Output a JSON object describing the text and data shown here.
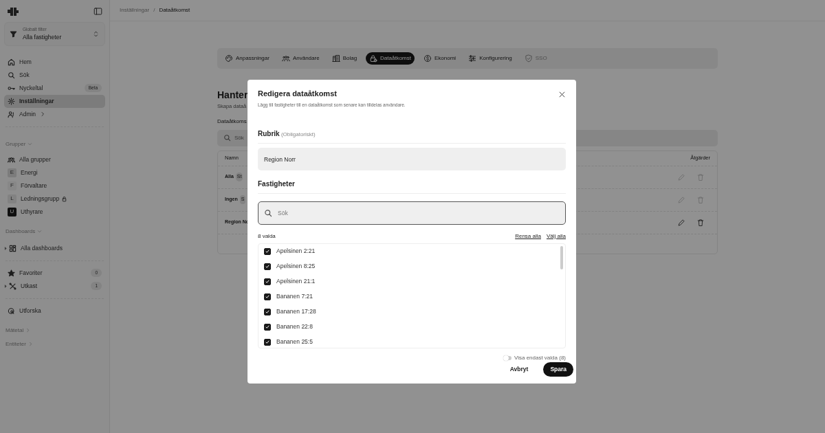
{
  "sidebar": {
    "global_filter": {
      "label": "Globalt filter",
      "value": "Alla fastigheter"
    },
    "nav": [
      {
        "label": "Hem",
        "selected": false
      },
      {
        "label": "Sök",
        "selected": false
      },
      {
        "label": "Nyckeltal",
        "badge": "Beta",
        "selected": false
      },
      {
        "label": "Inställningar",
        "selected": true
      },
      {
        "label": "Admin",
        "chevron": true,
        "selected": false
      }
    ],
    "groups": {
      "title": "Grupper",
      "items": [
        {
          "label": "Alla grupper",
          "kind": "all"
        },
        {
          "label": "Energi",
          "kind": "avatar",
          "initial": "E",
          "color": "#7c7c7c"
        },
        {
          "label": "Förvaltare",
          "kind": "avatar",
          "initial": "F",
          "color": "#878787"
        },
        {
          "label": "Ledningsgrupp",
          "kind": "avatar",
          "initial": "L",
          "color": "#828282",
          "locked": true
        },
        {
          "label": "Uthyrare",
          "kind": "avatar",
          "initial": "U",
          "color": "#0f0f0f"
        }
      ]
    },
    "dashboards": {
      "title": "Dashboards",
      "items": [
        {
          "label": "Alla dashboards"
        }
      ]
    },
    "extra": [
      {
        "label": "Favoriter",
        "count": "0",
        "caret": false
      },
      {
        "label": "Utkast",
        "count": "1",
        "caret": true
      }
    ],
    "explore": "Utforska",
    "sections": [
      "Mätetal",
      "Entiteter"
    ]
  },
  "breadcrumb": [
    "Inställningar",
    "Dataåtkomst"
  ],
  "breadcrumb_separator": "/",
  "tabs": [
    {
      "label": "Anpassningar",
      "selected": false,
      "disabled": false
    },
    {
      "label": "Användare",
      "selected": false,
      "disabled": false
    },
    {
      "label": "Bolag",
      "selected": false,
      "disabled": false
    },
    {
      "label": "Dataåtkomst",
      "selected": true,
      "disabled": false
    },
    {
      "label": "Ekonomi",
      "selected": false,
      "disabled": false
    },
    {
      "label": "Konfigurering",
      "selected": false,
      "disabled": false
    },
    {
      "label": "SSO",
      "selected": false,
      "disabled": true
    }
  ],
  "page": {
    "title": "Hanter",
    "subtitle": "Skapa dataå",
    "section": "Dataåtkoms",
    "search_placeholder": "Sök",
    "table": {
      "columns": [
        "Namn",
        "Åtgärder"
      ],
      "rows": [
        {
          "name": "Alla",
          "tag": "St",
          "disabled": true
        },
        {
          "name": "Ingen",
          "tag": "S",
          "disabled": true
        },
        {
          "name": "Region No",
          "disabled": false
        }
      ]
    }
  },
  "modal": {
    "title": "Redigera dataåtkomst",
    "subtitle": "Lägg till fastigheter till en dataåtkomst som senare kan tilldelas användare.",
    "name_label": "Rubrik",
    "name_hint": "(Obligatoriskt)",
    "name_value": "Region Norr",
    "properties_label": "Fastigheter",
    "search_placeholder": "Sök",
    "selected_count": "8 valda",
    "clear_all": "Rensa alla",
    "select_all": "Välj alla",
    "properties": [
      {
        "label": "Apelsinen 2:21",
        "checked": true
      },
      {
        "label": "Apelsinen 8:25",
        "checked": true
      },
      {
        "label": "Apelsinen 21:1",
        "checked": true
      },
      {
        "label": "Bananen 7:21",
        "checked": true
      },
      {
        "label": "Bananen 17:28",
        "checked": true
      },
      {
        "label": "Bananen 22:8",
        "checked": true
      },
      {
        "label": "Bananen 25:5",
        "checked": true
      }
    ],
    "show_selected_only": {
      "label": "Visa endast valda (8)",
      "on": false
    },
    "buttons": {
      "cancel": "Avbryt",
      "save": "Spara"
    }
  }
}
